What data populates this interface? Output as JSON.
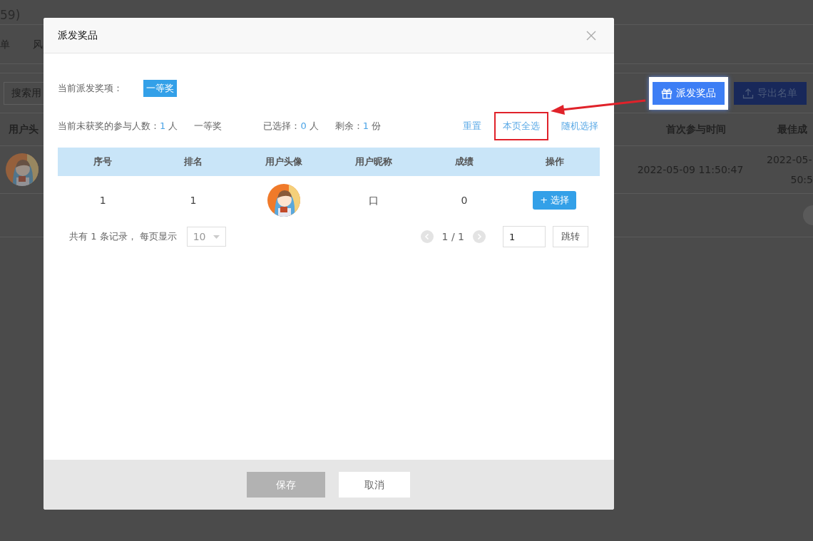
{
  "background": {
    "title_fragment": "59)",
    "tabs": [
      {
        "label": "单"
      },
      {
        "label": "风"
      }
    ],
    "search": {
      "placeholder": "搜索用"
    },
    "buttons": [
      {
        "label": "派发奖品",
        "kind": "gift",
        "highlighted": true
      },
      {
        "label": "导出名单",
        "kind": "export",
        "highlighted": false
      }
    ],
    "table": {
      "columns": [
        "用户头",
        "首次参与时间",
        "最佳成"
      ],
      "rows": [
        {
          "first_time": "2022-05-09 11:50:47",
          "best_time_lines": [
            "2022-05-",
            "50:5"
          ]
        }
      ]
    }
  },
  "dialog": {
    "title": "派发奖品",
    "prize_label": "当前派发奖项：",
    "prizes": [
      {
        "label": "一等奖",
        "selected": true
      }
    ],
    "stats": [
      {
        "label": "当前未获奖的参与人数：",
        "value": "1",
        "unit": "人"
      },
      {
        "label": "一等奖"
      },
      {
        "label": "已选择：",
        "value": "0",
        "unit": "人"
      },
      {
        "label": "剩余：",
        "value": "1",
        "unit": "份"
      }
    ],
    "actions": [
      {
        "label": "重置",
        "annotated": false
      },
      {
        "label": "本页全选",
        "annotated": true
      },
      {
        "label": "随机选择",
        "annotated": false
      }
    ],
    "table": {
      "columns": [
        "序号",
        "排名",
        "用户头像",
        "用户昵称",
        "成绩",
        "操作"
      ],
      "rows": [
        {
          "index": "1",
          "rank": "1",
          "nickname": "口",
          "score": "0",
          "button": "+ 选择"
        }
      ]
    },
    "pagination": {
      "summary": "共有 1 条记录， 每页显示",
      "page_size": "10",
      "pages": "1 / 1",
      "jump_value": "1",
      "jump_button": "跳转"
    },
    "footer": [
      {
        "label": "保存",
        "disabled": true
      },
      {
        "label": "取消",
        "disabled": false
      }
    ]
  }
}
